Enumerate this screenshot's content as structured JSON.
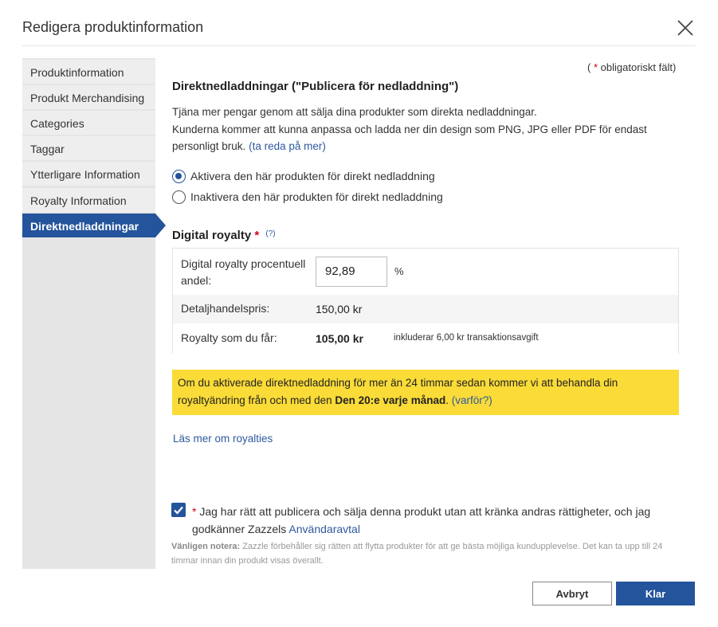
{
  "dialog": {
    "title": "Redigera produktinformation",
    "close_icon": "close-icon"
  },
  "sidebar": {
    "items": [
      {
        "label": "Produktinformation"
      },
      {
        "label": "Produkt Merchandising"
      },
      {
        "label": "Categories"
      },
      {
        "label": "Taggar"
      },
      {
        "label": "Ytterligare Information"
      },
      {
        "label": "Royalty Information"
      },
      {
        "label": "Direktnedladdningar",
        "active": true
      }
    ]
  },
  "required_note": {
    "open": "(",
    "star": "*",
    "text": "obligatoriskt fält)"
  },
  "section": {
    "heading": "Direktnedladdningar (\"Publicera för nedladdning\")",
    "line1": "Tjäna mer pengar genom att sälja dina produkter som direkta nedladdningar.",
    "line2": "Kunderna kommer att kunna anpassa och ladda ner din design som PNG, JPG eller PDF för endast personligt bruk.",
    "learn_link": "(ta reda på mer)"
  },
  "options": {
    "enable": "Aktivera den här produkten för direkt nedladdning",
    "disable": "Inaktivera den här produkten för direkt nedladdning",
    "selected": "enable"
  },
  "royalty": {
    "heading": "Digital royalty",
    "star": "*",
    "help": "(?)",
    "percent_label": "Digital royalty procentuell andel:",
    "percent_value": "92,89",
    "percent_symbol": "%",
    "retail_label": "Detaljhandelspris:",
    "retail_value": "150,00 kr",
    "earn_label": "Royalty som du får:",
    "earn_value": "105,00 kr",
    "fee_note": "inkluderar 6,00 kr transaktionsavgift"
  },
  "notice": {
    "text": "Om du aktiverade direktnedladdning för mer än 24 timmar sedan kommer vi att behandla din royaltyändring från och med den",
    "bold": "Den 20:e varje månad",
    "end": ".",
    "why_link": "(varför?)",
    "color": "#fadb37"
  },
  "learn_more": "Läs mer om royalties",
  "consent": {
    "checked": true,
    "star": "*",
    "text": "Jag har rätt att publicera och sälja denna produkt utan att kränka andras rättigheter, och jag godkänner Zazzels",
    "link": "Användaravtal"
  },
  "note": {
    "bold": "Vänligen notera:",
    "text": "Zazzle förbehåller sig rätten att flytta produkter för att ge bästa möjliga kundupplevelse. Det kan ta upp till 24 timmar innan din produkt visas överallt."
  },
  "buttons": {
    "cancel": "Avbryt",
    "ok": "Klar"
  },
  "colors": {
    "accent": "#24549b",
    "link": "#2e5a9e",
    "required": "#d0021b"
  }
}
